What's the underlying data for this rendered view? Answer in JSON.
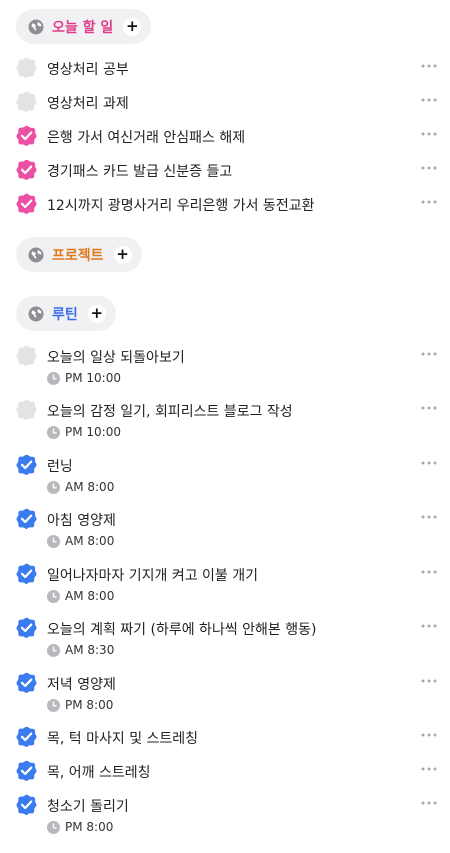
{
  "colors": {
    "today": "#e13c8c",
    "project": "#e0781e",
    "routine": "#3c6ee6",
    "today_check": "#ec4fa3",
    "routine_check": "#3b7bf0",
    "empty_check": "#e3e3e5"
  },
  "sections": {
    "today": {
      "title": "오늘 할 일",
      "icon": "globe-icon",
      "tasks": [
        {
          "title": "영상처리 공부",
          "done": false
        },
        {
          "title": "영상처리 과제",
          "done": false
        },
        {
          "title": "은행 가서 여신거래 안심패스 해제",
          "done": true
        },
        {
          "title": "경기패스 카드 발급 신분증 들고",
          "done": true
        },
        {
          "title": "12시까지 광명사거리 우리은행 가서 동전교환",
          "done": true
        }
      ]
    },
    "project": {
      "title": "프로젝트",
      "icon": "globe-icon"
    },
    "routine": {
      "title": "루틴",
      "icon": "globe-icon",
      "tasks": [
        {
          "title": "오늘의 일상 되돌아보기",
          "done": false,
          "time": "PM 10:00"
        },
        {
          "title": "오늘의 감정 일기, 회피리스트 블로그 작성",
          "done": false,
          "time": "PM 10:00"
        },
        {
          "title": "런닝",
          "done": true,
          "time": "AM 8:00"
        },
        {
          "title": "아침 영양제",
          "done": true,
          "time": "AM 8:00"
        },
        {
          "title": "일어나자마자 기지개 켜고 이불 개기",
          "done": true,
          "time": "AM 8:00"
        },
        {
          "title": "오늘의 계획 짜기 (하루에 하나씩 안해본 행동)",
          "done": true,
          "time": "AM 8:30"
        },
        {
          "title": "저녁 영양제",
          "done": true,
          "time": "PM 8:00"
        },
        {
          "title": "목, 턱 마사지 및 스트레칭",
          "done": true
        },
        {
          "title": "목, 어깨 스트레칭",
          "done": true
        },
        {
          "title": "청소기 돌리기",
          "done": true,
          "time": "PM 8:00"
        }
      ]
    }
  }
}
